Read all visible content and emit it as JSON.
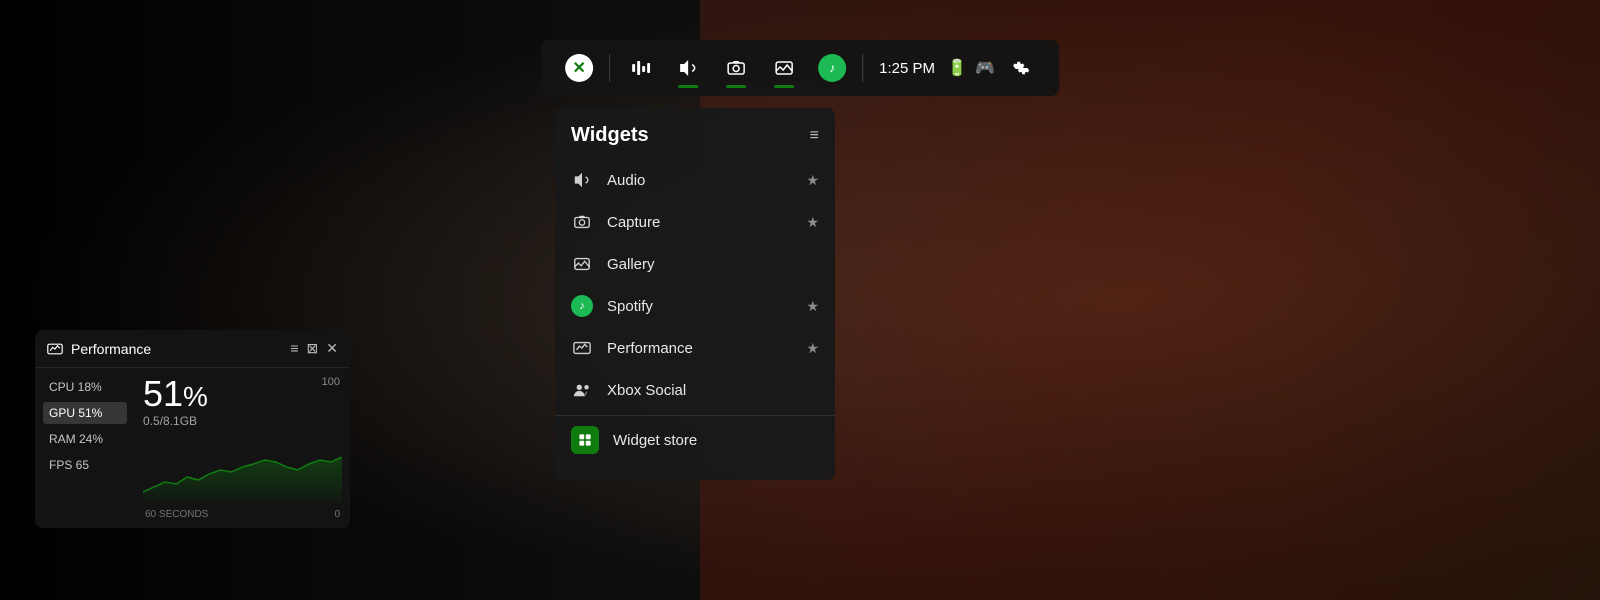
{
  "background": {
    "color_left": "#000000",
    "color_right": "#4a3020"
  },
  "topbar": {
    "time": "1:25 PM",
    "icons": [
      {
        "name": "xbox",
        "label": "Xbox",
        "type": "xbox-logo"
      },
      {
        "name": "activity",
        "label": "Activity"
      },
      {
        "name": "audio",
        "label": "Audio",
        "active": true
      },
      {
        "name": "capture",
        "label": "Capture",
        "active": true
      },
      {
        "name": "gallery",
        "label": "Gallery",
        "active": true
      },
      {
        "name": "spotify",
        "label": "Spotify",
        "type": "spotify"
      },
      {
        "name": "time",
        "label": "1:25 PM"
      },
      {
        "name": "battery",
        "label": "Battery"
      },
      {
        "name": "controller",
        "label": "Controller"
      },
      {
        "name": "settings",
        "label": "Settings"
      }
    ]
  },
  "widgets_panel": {
    "title": "Widgets",
    "items": [
      {
        "id": "audio",
        "label": "Audio",
        "icon": "🔊",
        "starred": true
      },
      {
        "id": "capture",
        "label": "Capture",
        "icon": "📷",
        "starred": true
      },
      {
        "id": "gallery",
        "label": "Gallery",
        "icon": "🖥"
      },
      {
        "id": "spotify",
        "label": "Spotify",
        "icon": "spotify",
        "starred": true
      },
      {
        "id": "performance",
        "label": "Performance",
        "icon": "🖥",
        "starred": true
      },
      {
        "id": "xbox-social",
        "label": "Xbox Social",
        "icon": "👤"
      }
    ],
    "store": {
      "label": "Widget store",
      "icon": "store"
    },
    "filter_icon": "≡"
  },
  "performance_widget": {
    "title": "Performance",
    "stats": [
      {
        "label": "CPU 18%"
      },
      {
        "label": "GPU 51%",
        "active": true
      },
      {
        "label": "RAM 24%"
      },
      {
        "label": "FPS 65"
      }
    ],
    "big_value": "51",
    "big_suffix": "%",
    "sub_value": "0.5/8.1GB",
    "chart_max": "100",
    "chart_labels": [
      "60 SECONDS",
      "0"
    ],
    "chart_color": "#107C10"
  }
}
